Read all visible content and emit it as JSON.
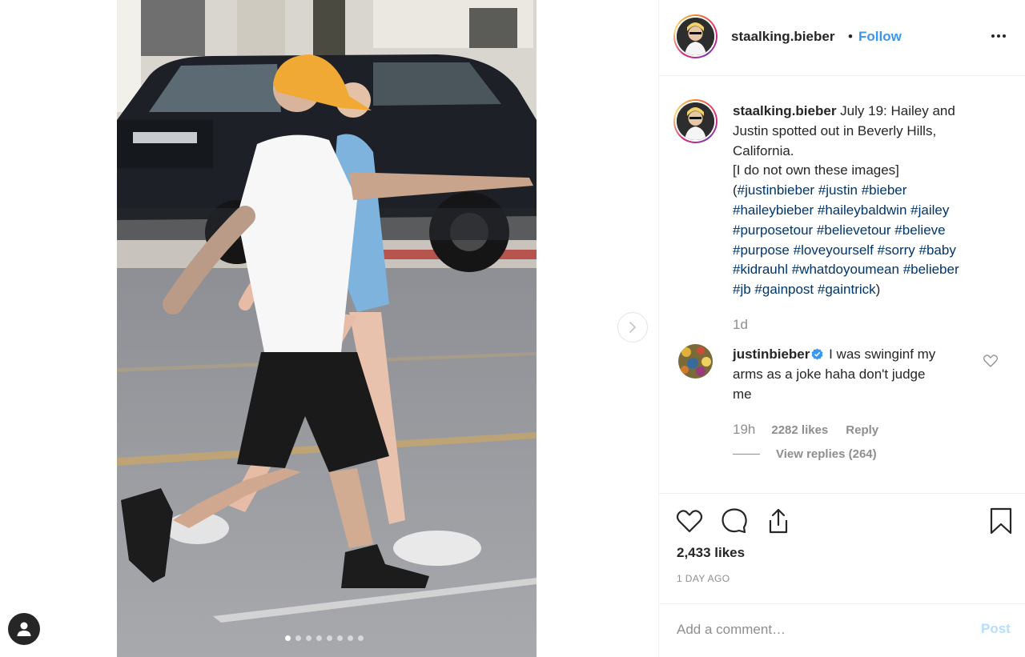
{
  "post": {
    "username": "staalking.bieber",
    "follow_label": "Follow",
    "separator": "•",
    "caption_lines": [
      "July 19: Hailey and",
      "Justin spotted out in Beverly Hills,",
      "California.",
      "[I do not own these images]"
    ],
    "hashtag_lines": [
      [
        "(",
        "#justinbieber",
        " ",
        "#justin",
        " ",
        "#bieber"
      ],
      [
        "#haileybieber",
        " ",
        "#haileybaldwin",
        " ",
        "#jailey"
      ],
      [
        "#purposetour",
        " ",
        "#believetour",
        " ",
        "#believe"
      ],
      [
        "#purpose",
        " ",
        "#loveyourself",
        " ",
        "#sorry",
        " ",
        "#baby"
      ],
      [
        "#kidrauhl",
        " ",
        "#whatdoyoumean",
        " ",
        "#belieber"
      ],
      [
        "#jb",
        " ",
        "#gainpost",
        " ",
        "#gaintrick",
        ")"
      ]
    ],
    "caption_age": "1d",
    "carousel": {
      "total": 8,
      "active": 1
    },
    "likes": "2,433 likes",
    "age": "1 DAY AGO"
  },
  "comment": {
    "username": "justinbieber",
    "text": "I was swinginf my",
    "text_lines": [
      "arms as a joke haha don't judge",
      "me"
    ],
    "age": "19h",
    "likes": "2282 likes",
    "reply_label": "Reply",
    "view_replies_label": "View replies (264)"
  },
  "composer": {
    "placeholder": "Add a comment…",
    "post_label": "Post"
  },
  "icons": {
    "more": "more-horizontal-icon",
    "next": "chevron-right-icon",
    "verified": "verified-badge-icon",
    "like": "heart-icon",
    "comment": "comment-bubble-icon",
    "share": "share-icon",
    "save": "bookmark-icon",
    "profile": "profile-icon"
  },
  "colors": {
    "link_blue": "#3897f0",
    "hashtag": "#003569",
    "muted": "#8e8e8e",
    "text": "#262626",
    "post_disabled": "#b2dffc"
  }
}
